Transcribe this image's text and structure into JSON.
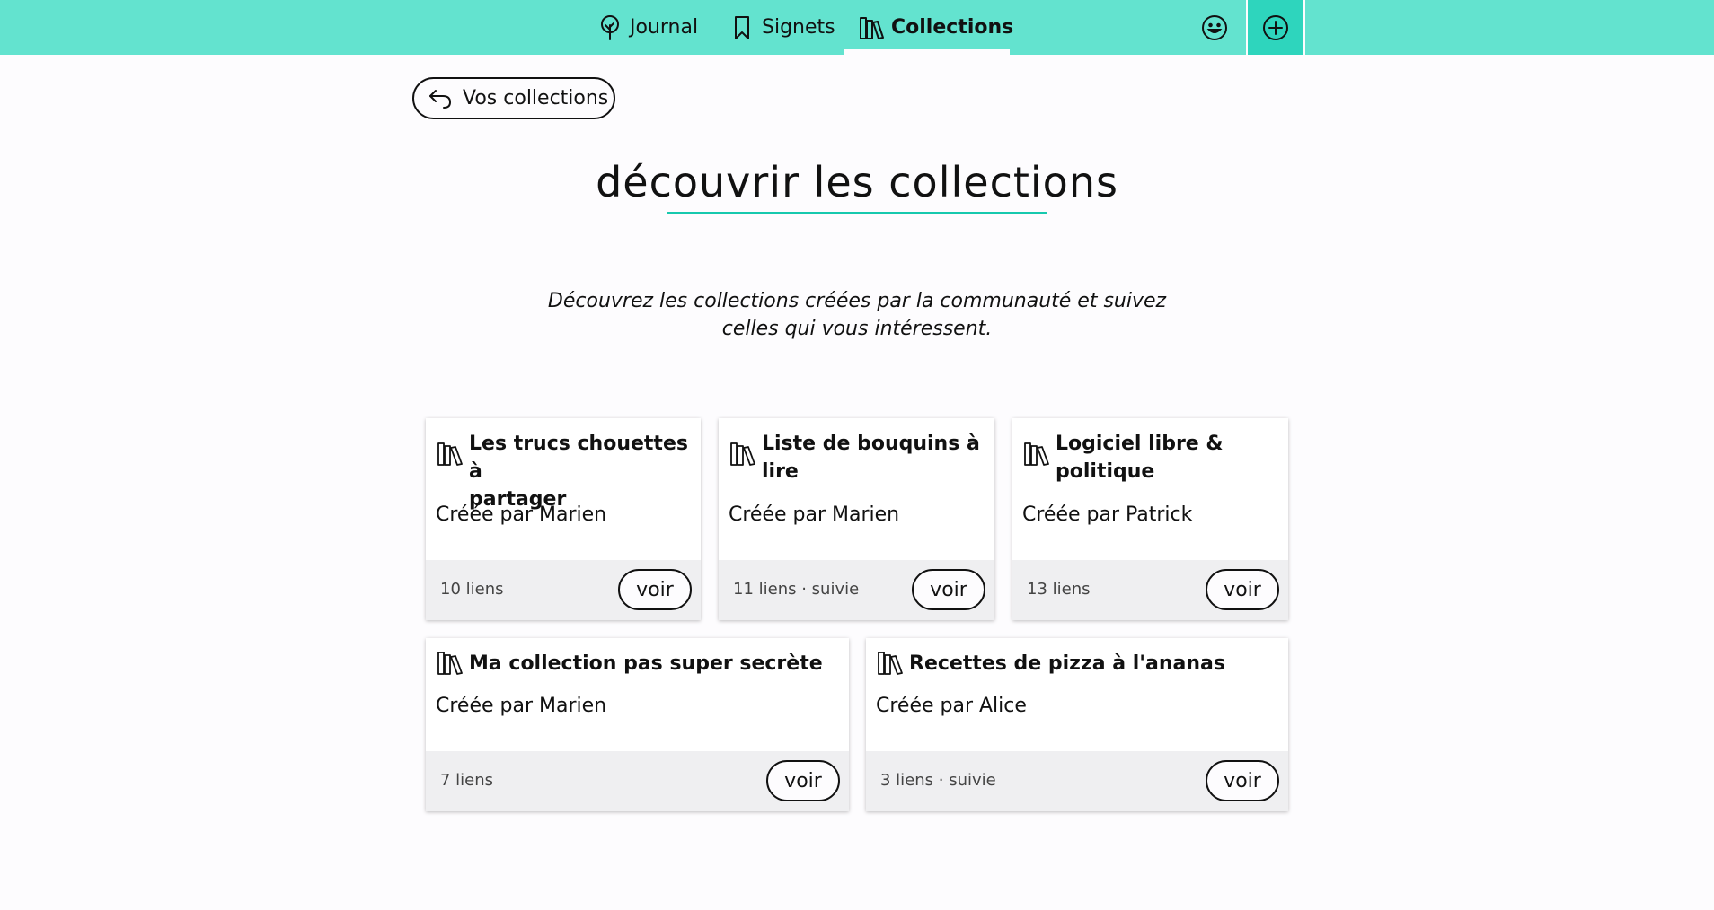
{
  "nav": {
    "items": [
      {
        "label": "Journal",
        "icon": "tree-icon"
      },
      {
        "label": "Signets",
        "icon": "bookmark-icon"
      },
      {
        "label": "Collections",
        "icon": "books-icon",
        "active": true
      }
    ],
    "account_icon": "smiley-icon",
    "add_icon": "plus-circle-icon"
  },
  "back_button": {
    "label": "Vos collections",
    "icon": "return-arrow-icon"
  },
  "page": {
    "title": "découvrir les collections",
    "intro_line1": "Découvrez les collections créées par la communauté et suivez",
    "intro_line2": "celles qui vous intéressent."
  },
  "cards": [
    {
      "title_line1": "Les trucs chouettes à",
      "title_line2": "partager",
      "author": "Créée par Marien",
      "meta": "10 liens",
      "button": "voir"
    },
    {
      "title_line1": "Liste de bouquins à",
      "title_line2": "lire",
      "author": "Créée par Marien",
      "meta": "11 liens · suivie",
      "button": "voir"
    },
    {
      "title_line1": "Logiciel libre &",
      "title_line2": "politique",
      "author": "Créée par Patrick",
      "meta": "13 liens",
      "button": "voir"
    },
    {
      "title_line1": "Ma collection pas super secrète",
      "author": "Créée par Marien",
      "meta": "7 liens",
      "button": "voir"
    },
    {
      "title_line1": "Recettes de pizza à l'ananas",
      "author": "Créée par Alice",
      "meta": "3 liens · suivie",
      "button": "voir"
    }
  ],
  "colors": {
    "topbar": "#63e3cf",
    "accent": "#17c9ae",
    "plus_bg": "#2ed5bd",
    "card_footer": "#efeff1"
  }
}
